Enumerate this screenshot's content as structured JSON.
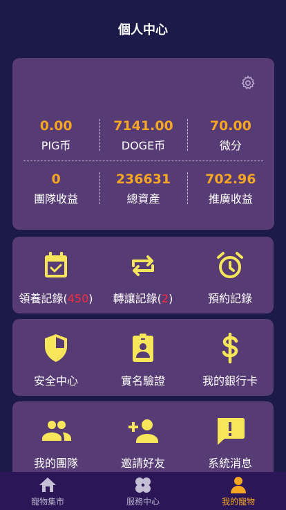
{
  "header": {
    "title": "個人中心"
  },
  "stats": {
    "row1": [
      {
        "value": "0.00",
        "label": "PIG币"
      },
      {
        "value": "7141.00",
        "label": "DOGE币"
      },
      {
        "value": "70.00",
        "label": "微分"
      }
    ],
    "row2": [
      {
        "value": "0",
        "label": "團隊收益"
      },
      {
        "value": "236631",
        "label": "總資產"
      },
      {
        "value": "702.96",
        "label": "推廣收益"
      }
    ]
  },
  "menu": {
    "adopt_records": {
      "label": "領養記錄(",
      "count": "450",
      "suffix": ")"
    },
    "transfer_records": {
      "label": "轉讓記錄(",
      "count": "2",
      "suffix": ")"
    },
    "reserve_records": {
      "label": "預約記錄"
    },
    "security": {
      "label": "安全中心"
    },
    "realname": {
      "label": "實名驗證"
    },
    "bankcard": {
      "label": "我的銀行卡"
    },
    "team": {
      "label": "我的團隊"
    },
    "invite": {
      "label": "邀請好友"
    },
    "messages": {
      "label": "系統消息"
    }
  },
  "tabbar": {
    "market": "寵物集市",
    "service": "服務中心",
    "mine": "我的寵物"
  },
  "colors": {
    "background": "#1c1a48",
    "card": "#573b74",
    "accent": "#f5a623",
    "icon": "#f7e65a",
    "count_red": "#ff2a3c",
    "tabbar": "#2b1758"
  }
}
